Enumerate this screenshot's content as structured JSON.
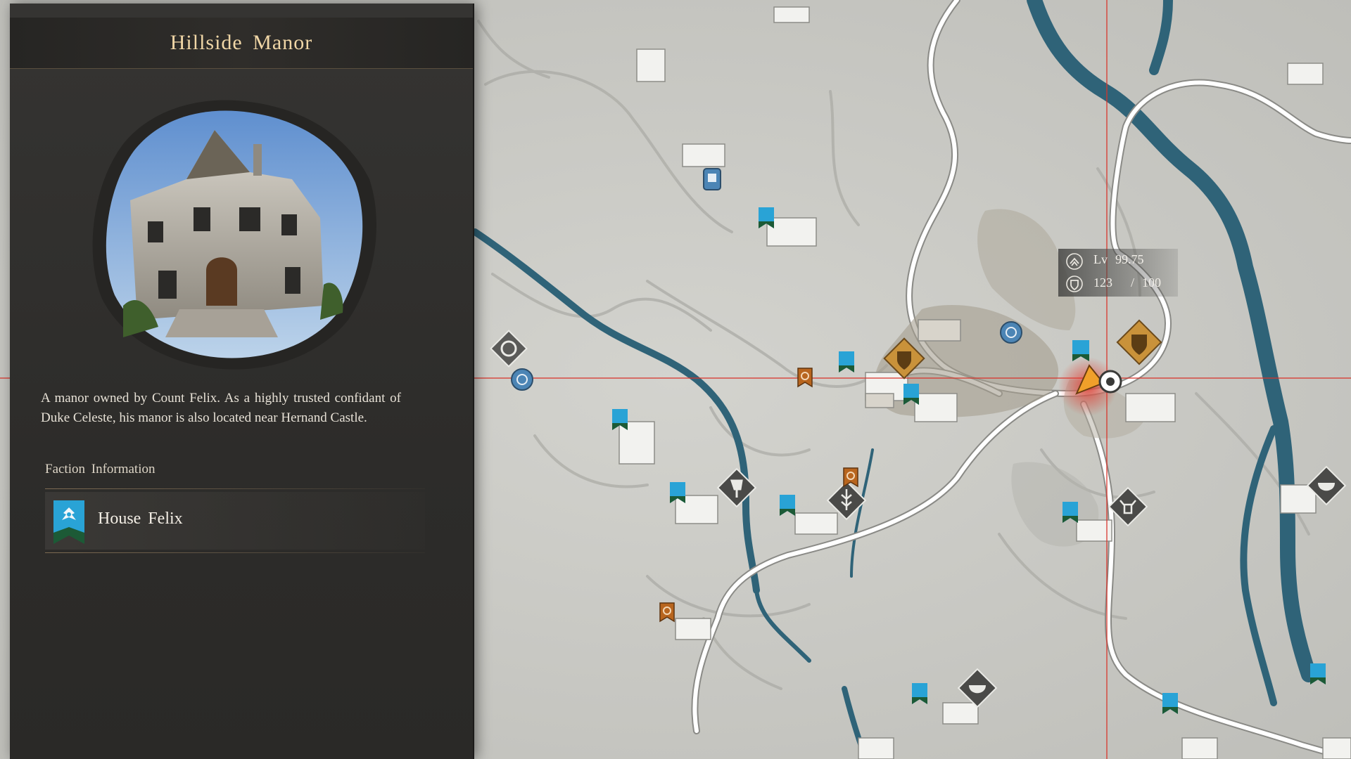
{
  "location": {
    "title": "Hillside Manor",
    "description": "A manor owned by Count Felix. As a highly trusted confidant of Duke Celeste, his manor is also located near Hernand Castle.",
    "faction_heading": "Faction Information",
    "faction_name": "House Felix"
  },
  "player_status": {
    "level_label": "Lv",
    "level_value": "99.75",
    "power_value": "123",
    "power_separator": "/",
    "power_max": "100"
  },
  "colors": {
    "map_paper": "#c9c9c4",
    "river": "#2f6378",
    "road": "#ffffff",
    "crosshair": "#d9342b",
    "panel": "#2f2e2c",
    "title_gold": "#f0d6a6",
    "faction_blue": "#29a3d6",
    "faction_green": "#1c5a36",
    "quest_orange": "#b8651e",
    "keep_gold": "#c9923a"
  },
  "map_icons": [
    "wheel-icon",
    "waypoint-icon",
    "faction-banner-icon",
    "quest-hand-icon",
    "axe-icon",
    "wheat-icon",
    "shield-keep-icon",
    "bull-icon",
    "cauldron-icon",
    "player-arrow-icon",
    "target-marker-icon"
  ]
}
